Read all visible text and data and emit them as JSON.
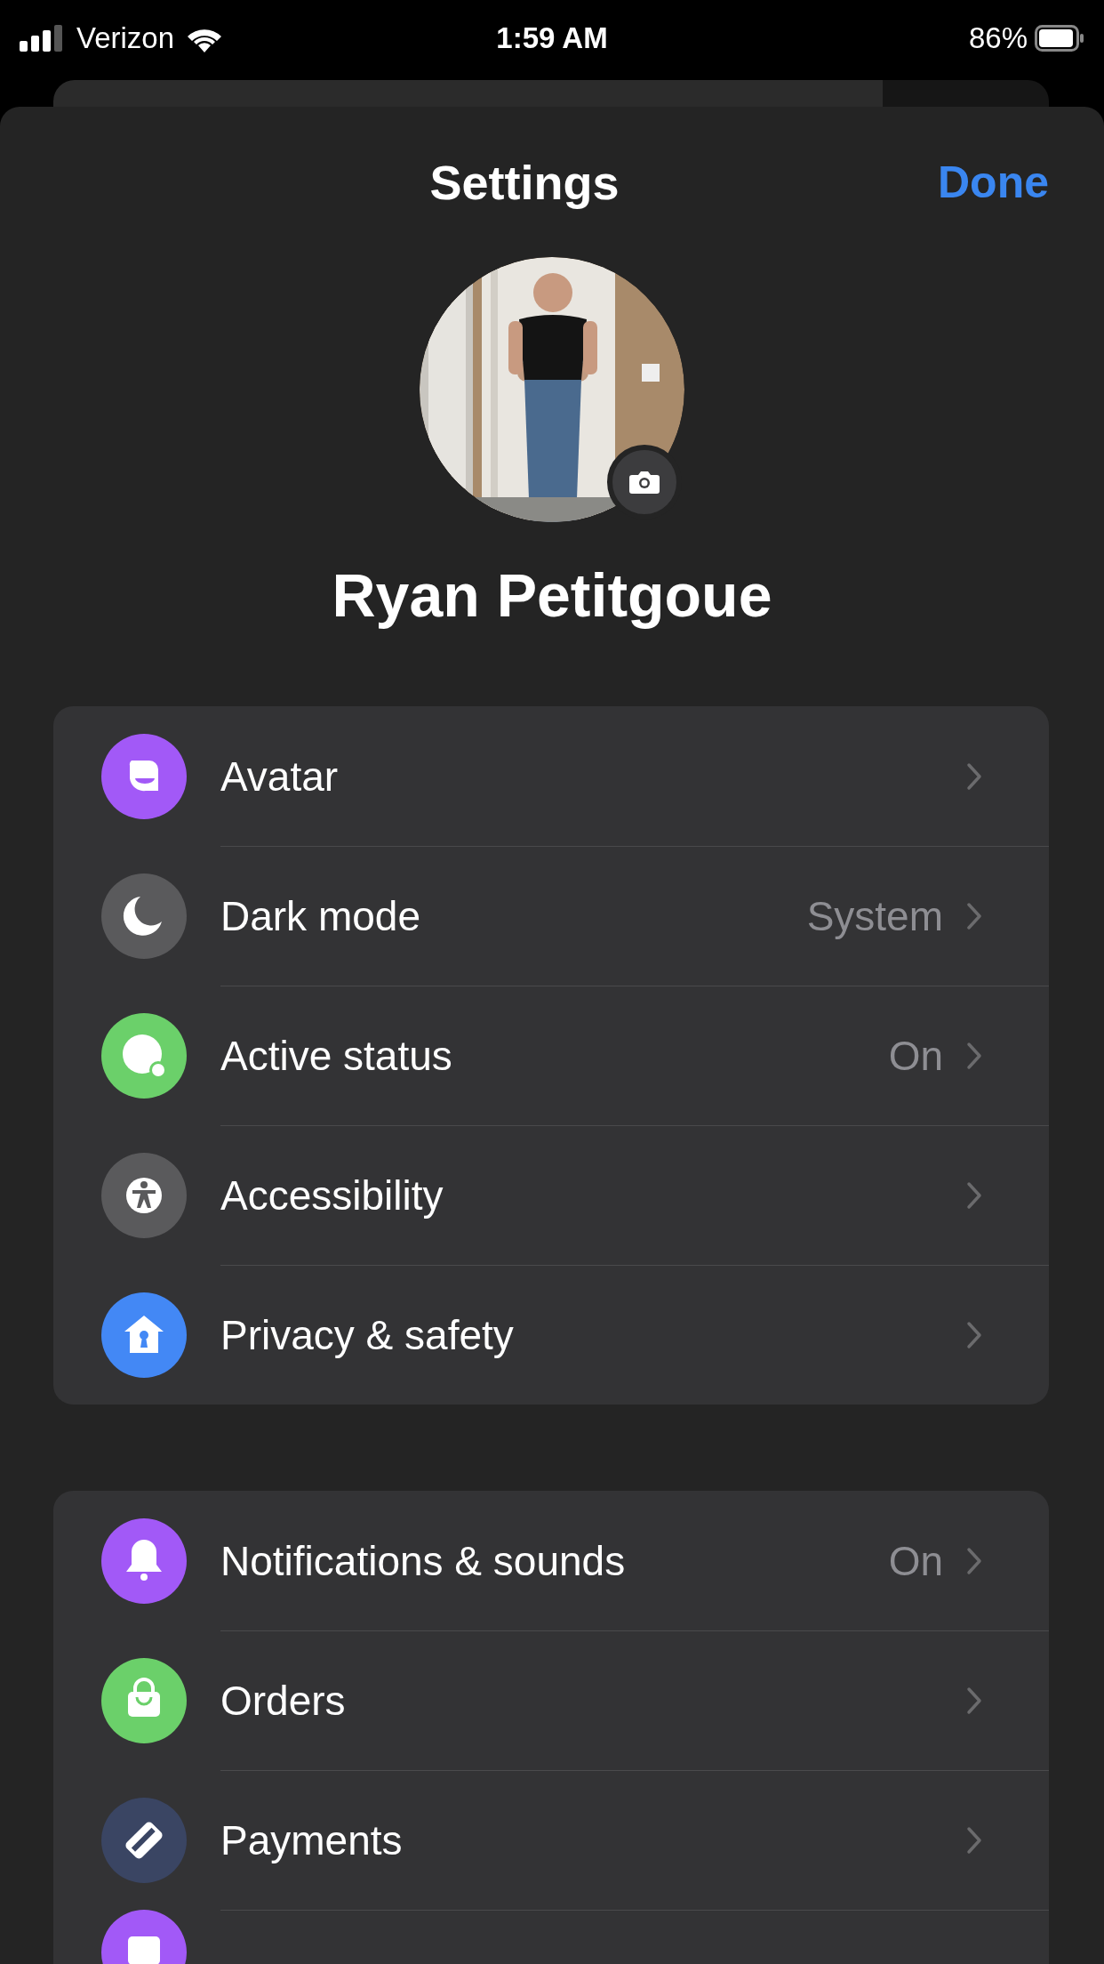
{
  "status_bar": {
    "carrier": "Verizon",
    "time": "1:59 AM",
    "battery": "86%"
  },
  "header": {
    "title": "Settings",
    "done": "Done"
  },
  "profile": {
    "name": "Ryan Petitgoue"
  },
  "groups": [
    {
      "rows": [
        {
          "color": "#a259f7",
          "label": "Avatar"
        },
        {
          "color": "#5a5a5c",
          "label": "Dark mode",
          "value": "System"
        },
        {
          "color": "#6bd06a",
          "label": "Active status",
          "value": "On"
        },
        {
          "color": "#5a5a5c",
          "label": "Accessibility"
        },
        {
          "color": "#4388f5",
          "label": "Privacy & safety"
        }
      ]
    },
    {
      "rows": [
        {
          "color": "#a259f7",
          "label": "Notifications & sounds",
          "value": "On"
        },
        {
          "color": "#6bd06a",
          "label": "Orders"
        },
        {
          "color": "#3a4563",
          "label": "Payments"
        },
        {
          "color": "#a259f7"
        }
      ]
    }
  ]
}
